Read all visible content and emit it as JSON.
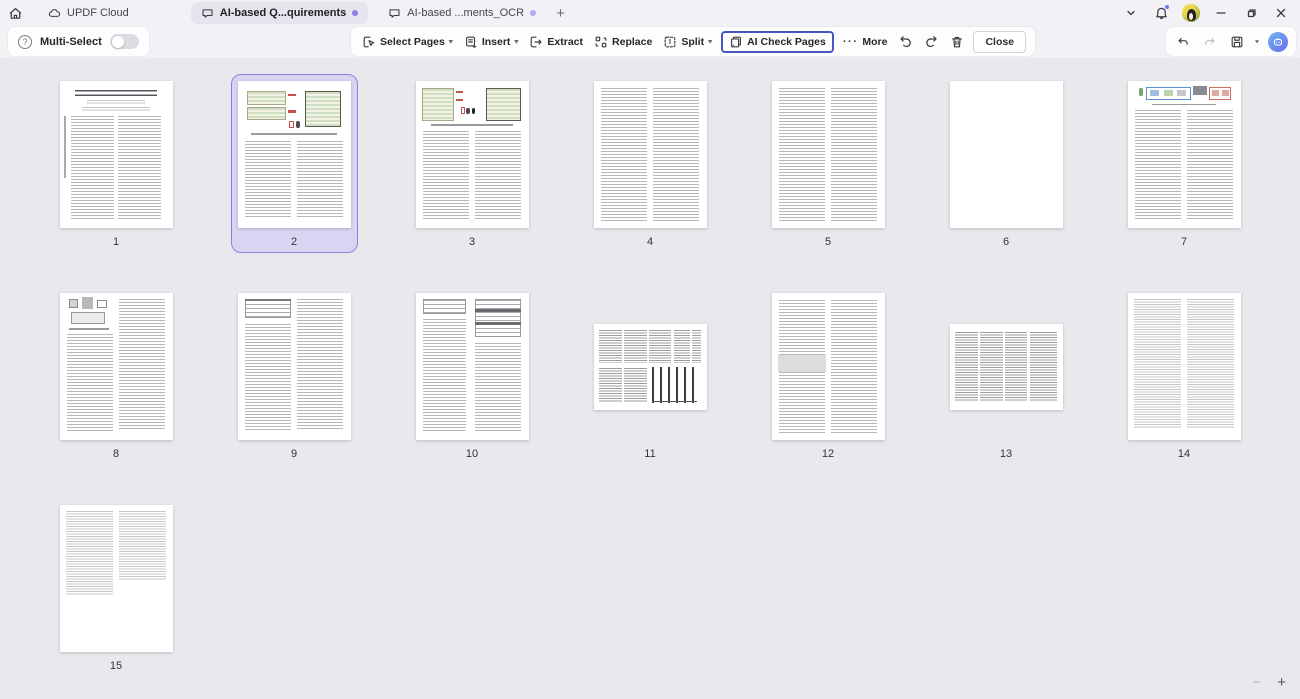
{
  "titlebar": {
    "home_tab": {
      "label": "UPDF Cloud"
    },
    "tabs": [
      {
        "label": "AI-based Q...quirements",
        "active": true,
        "modified": true
      },
      {
        "label": "AI-based ...ments_OCR",
        "active": false,
        "modified": true
      }
    ]
  },
  "toolbar": {
    "multi_select": {
      "label": "Multi-Select",
      "enabled": false
    },
    "buttons": [
      {
        "label": "Select Pages",
        "dropdown": true
      },
      {
        "label": "Insert",
        "dropdown": true
      },
      {
        "label": "Extract",
        "dropdown": false
      },
      {
        "label": "Replace",
        "dropdown": false
      },
      {
        "label": "Split",
        "dropdown": true
      },
      {
        "label": "AI Check Pages",
        "dropdown": false,
        "highlighted": true
      },
      {
        "label": "More",
        "dropdown": false
      }
    ],
    "close_label": "Close"
  },
  "pages": [
    {
      "number": "1",
      "kind": "title-two-col",
      "orientation": "portrait",
      "selected": false
    },
    {
      "number": "2",
      "kind": "figure-tables",
      "orientation": "portrait",
      "selected": true
    },
    {
      "number": "3",
      "kind": "figure-tables-wide",
      "orientation": "portrait",
      "selected": false
    },
    {
      "number": "4",
      "kind": "text-two-col",
      "orientation": "portrait",
      "selected": false
    },
    {
      "number": "5",
      "kind": "text-two-col",
      "orientation": "portrait",
      "selected": false
    },
    {
      "number": "6",
      "kind": "blank",
      "orientation": "portrait",
      "selected": false
    },
    {
      "number": "7",
      "kind": "diagram-color",
      "orientation": "portrait",
      "selected": false
    },
    {
      "number": "8",
      "kind": "diagram-gray",
      "orientation": "portrait",
      "selected": false
    },
    {
      "number": "9",
      "kind": "table-left",
      "orientation": "portrait",
      "selected": false
    },
    {
      "number": "10",
      "kind": "tables-top",
      "orientation": "portrait",
      "selected": false
    },
    {
      "number": "11",
      "kind": "landscape-bars",
      "orientation": "landscape",
      "selected": false
    },
    {
      "number": "12",
      "kind": "text-highlight",
      "orientation": "portrait",
      "selected": false
    },
    {
      "number": "13",
      "kind": "landscape-text",
      "orientation": "landscape",
      "selected": false
    },
    {
      "number": "14",
      "kind": "references",
      "orientation": "portrait",
      "selected": false
    },
    {
      "number": "15",
      "kind": "references-partial",
      "orientation": "portrait",
      "selected": false
    }
  ],
  "zoom": {
    "out": "−",
    "in": "+"
  },
  "colors": {
    "selection_border": "#8b80e0",
    "selection_fill": "#d9d4f2",
    "ai_button_border": "#4a55c4",
    "tab_modified_dot": "#8b7fe8",
    "titlebar_bg": "#f2f1f6",
    "canvas_bg": "#e9e8ed"
  }
}
